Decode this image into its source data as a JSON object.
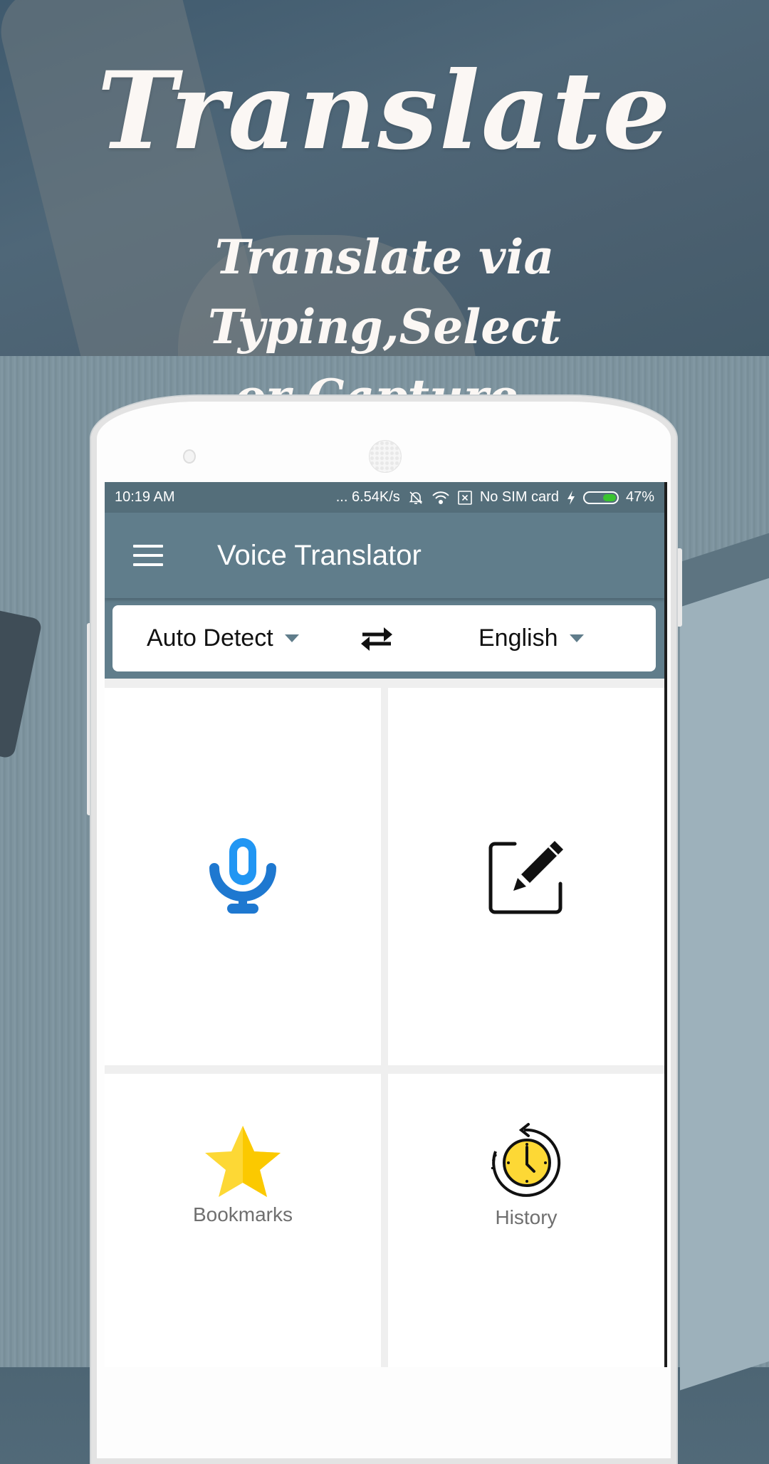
{
  "promo": {
    "headline": "Translate",
    "subline_1": "Translate via Typing,Select",
    "subline_2": "or Capture."
  },
  "status_bar": {
    "time": "10:19 AM",
    "network_speed": "... 6.54K/s",
    "sim_status": "No SIM card",
    "battery_percent": "47%",
    "battery_level": 0.47,
    "icons": [
      "mute-bell-icon",
      "wifi-icon",
      "sim-x-icon",
      "charging-bolt-icon",
      "battery-icon"
    ]
  },
  "app_bar": {
    "title": "Voice Translator",
    "menu_icon": "hamburger-menu-icon"
  },
  "language_selector": {
    "source_language": "Auto Detect",
    "target_language": "English",
    "swap_icon": "swap-arrows-icon"
  },
  "tiles": [
    {
      "name": "voice",
      "icon": "microphone-icon",
      "label": ""
    },
    {
      "name": "type",
      "icon": "edit-pencil-icon",
      "label": ""
    },
    {
      "name": "bookmarks",
      "icon": "star-icon",
      "label": "Bookmarks"
    },
    {
      "name": "history",
      "icon": "clock-history-icon",
      "label": "History"
    }
  ],
  "colors": {
    "primary": "#607d8b",
    "status_bar": "#546e7a",
    "mic_blue": "#1e88e5",
    "star_yellow": "#fdd835",
    "battery_green": "#3ac430"
  }
}
